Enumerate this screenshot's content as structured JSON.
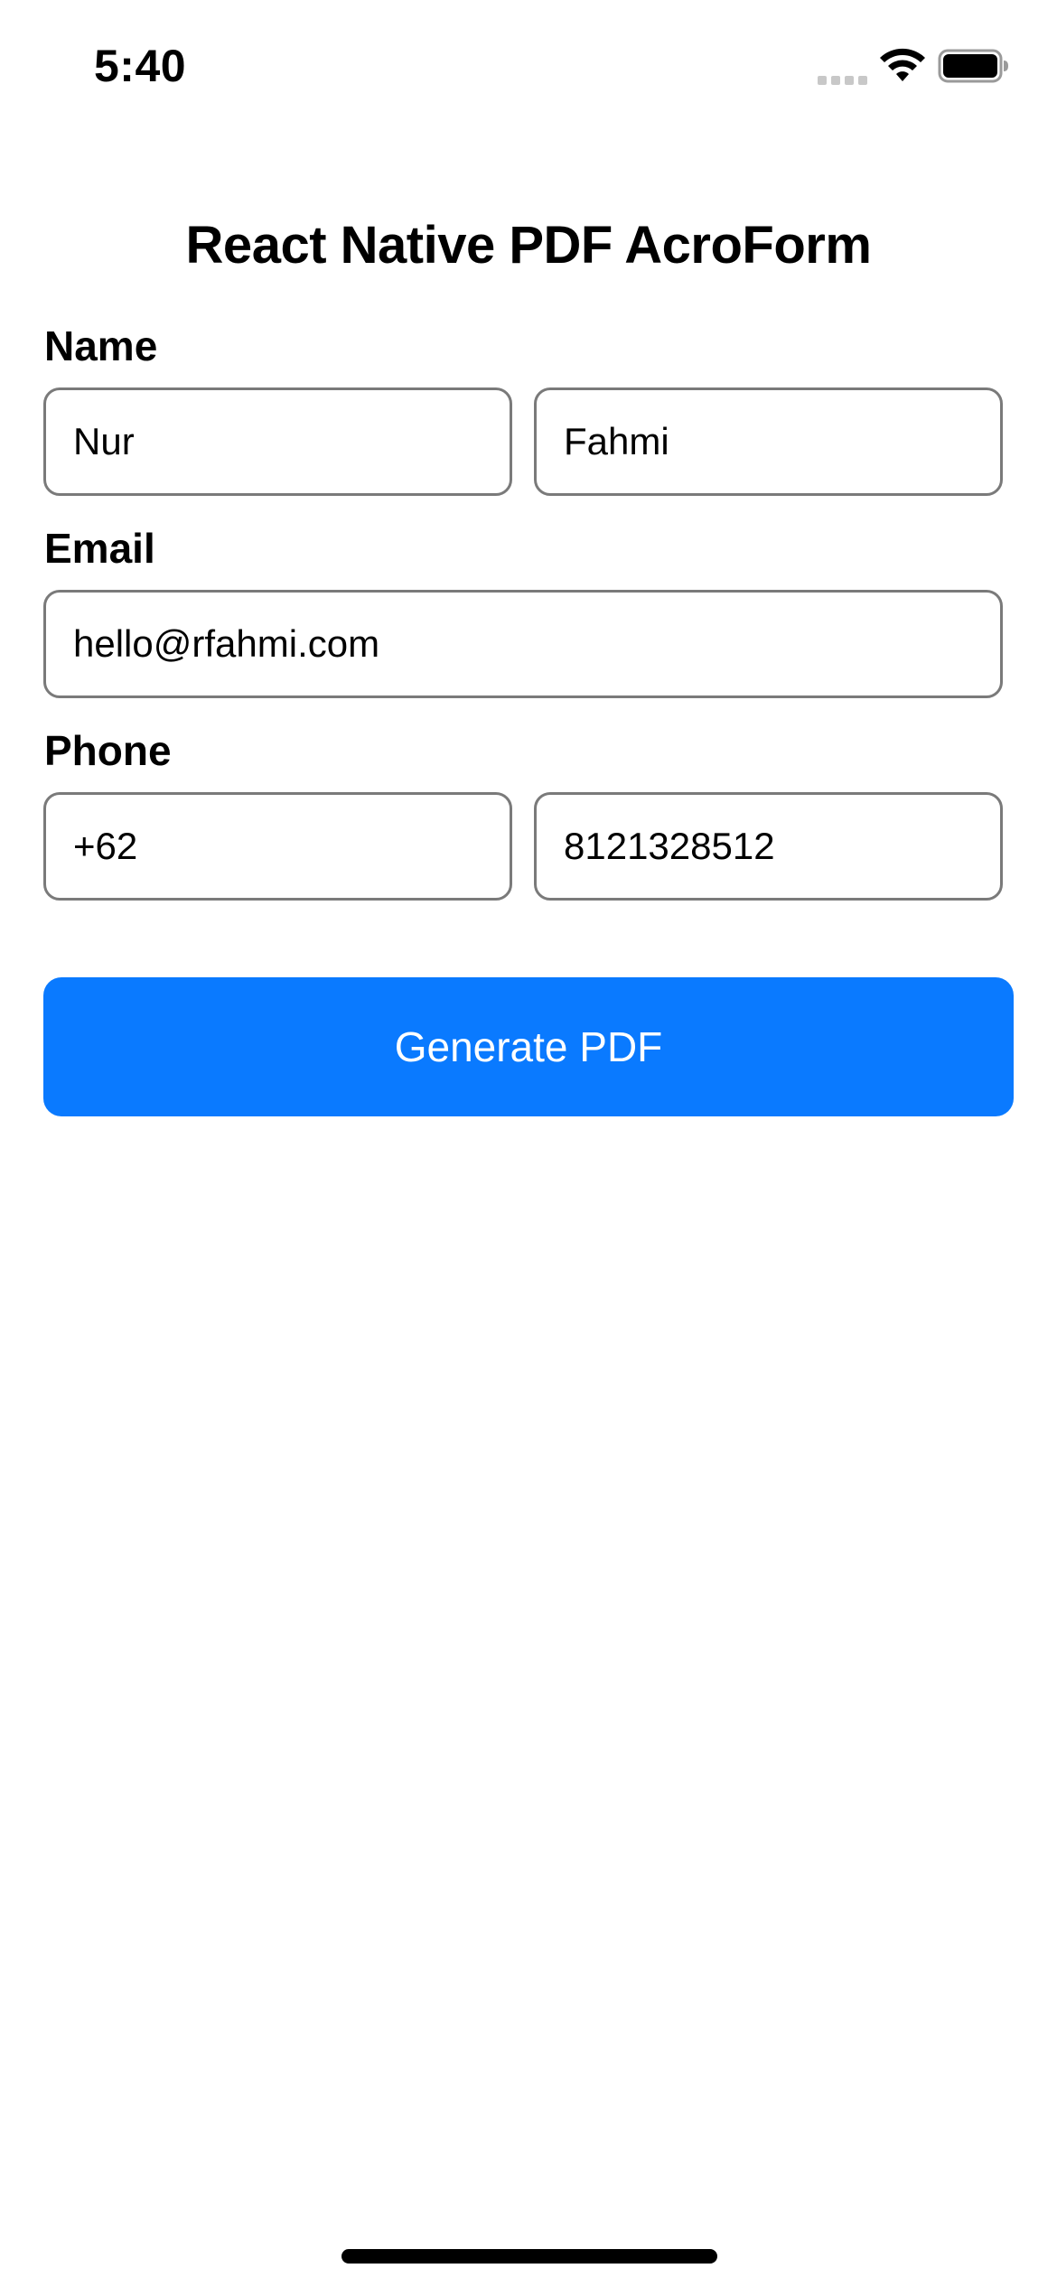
{
  "status_bar": {
    "time": "5:40",
    "icons": [
      "signal-icon",
      "wifi-icon",
      "battery-icon"
    ]
  },
  "page": {
    "title": "React Native PDF AcroForm"
  },
  "form": {
    "name": {
      "label": "Name",
      "first": "Nur",
      "last": "Fahmi"
    },
    "email": {
      "label": "Email",
      "value": "hello@rfahmi.com"
    },
    "phone": {
      "label": "Phone",
      "country_code": "+62",
      "number": "8121328512"
    },
    "submit_label": "Generate PDF"
  },
  "colors": {
    "accent": "#0a7aff",
    "field_border": "#7a7a7a",
    "background": "#ffffff"
  }
}
